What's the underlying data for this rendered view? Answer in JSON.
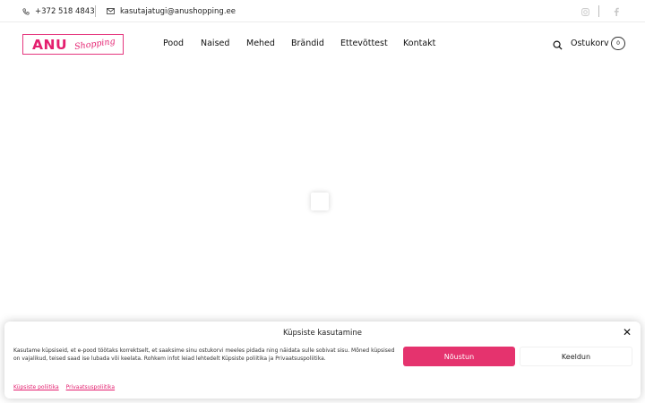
{
  "topbar": {
    "phone": "+372 518 4843",
    "email": "kasutajatugi@anushopping.ee",
    "social": [
      "instagram-icon",
      "facebook-icon"
    ]
  },
  "header": {
    "logo": {
      "main": "ANU",
      "script": "Shopping"
    },
    "nav": [
      {
        "label": "Pood"
      },
      {
        "label": "Naised"
      },
      {
        "label": "Mehed"
      },
      {
        "label": "Brändid"
      },
      {
        "label": "Ettevõttest"
      },
      {
        "label": "Kontakt"
      }
    ],
    "cart_label": "Ostukorv",
    "cart_count": "0"
  },
  "cookie": {
    "title": "Küpsiste kasutamine",
    "text": "Kasutame küpsiseid, et e-pood töötaks korrektselt, et saaksime sinu ostukorvi meeles pidada ning näidata sulle sobivat sisu. Mõned küpsised on vajalikud, teised saad ise lubada või keelata. Rohkem infot leiad lehtedelt Küpsiste poliitika ja Privaatsuspoliitika.",
    "accept_label": "Nõustun",
    "deny_label": "Keeldun",
    "links": [
      "Küpsiste poliitika",
      "Privaatsuspoliitika"
    ]
  },
  "colors": {
    "brand": "#e41f6f",
    "accept_button": "#e5336e"
  }
}
